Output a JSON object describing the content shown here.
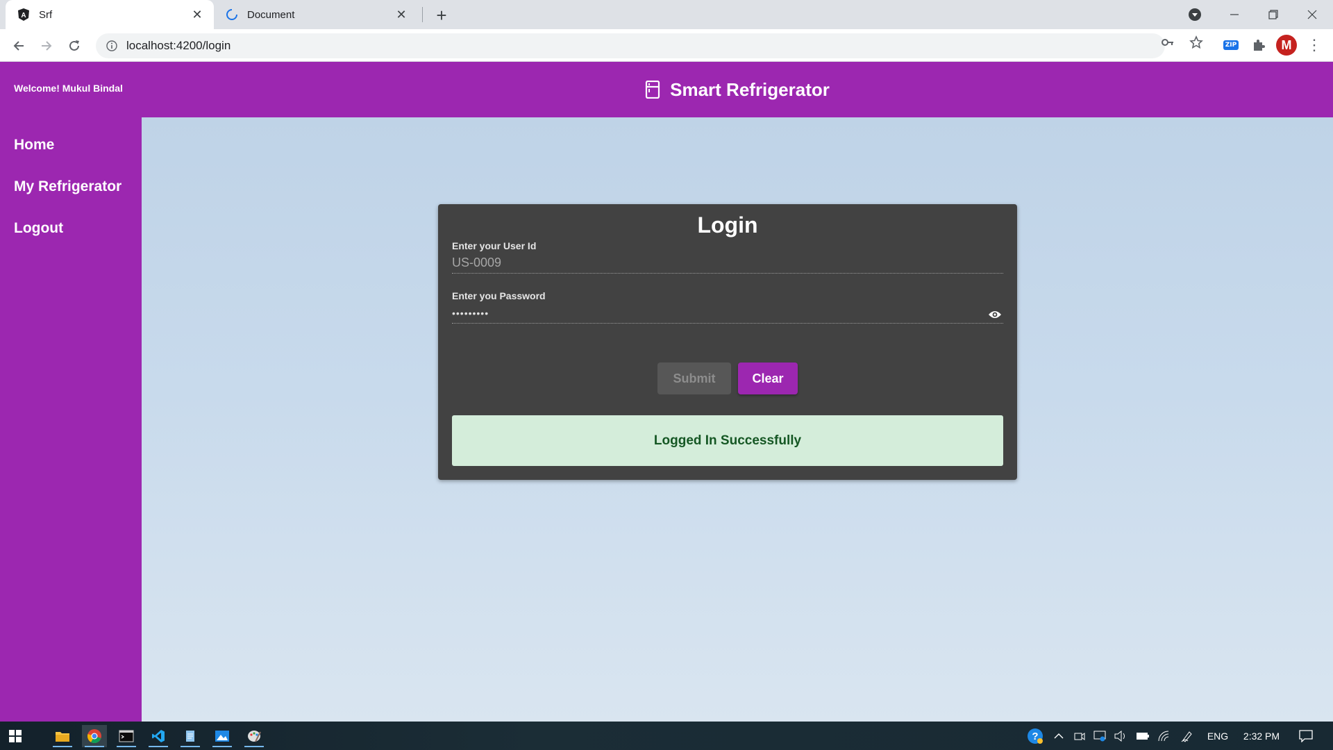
{
  "browser": {
    "tabs": [
      {
        "title": "Srf",
        "active": true
      },
      {
        "title": "Document",
        "active": false
      }
    ],
    "url": "localhost:4200/login"
  },
  "app": {
    "welcome": "Welcome! Mukul Bindal",
    "title": "Smart Refrigerator",
    "nav": [
      "Home",
      "My Refrigerator",
      "Logout"
    ]
  },
  "login": {
    "heading": "Login",
    "user_label": "Enter your User Id",
    "user_value": "US-0009",
    "password_label": "Enter you Password",
    "password_value": "•••••••••",
    "submit_label": "Submit",
    "clear_label": "Clear",
    "alert": "Logged In Successfully"
  },
  "colors": {
    "primary": "#9c27b0",
    "card": "#424242",
    "success_bg": "#d4edda",
    "success_text": "#155724"
  },
  "taskbar": {
    "language": "ENG",
    "time": "2:32 PM"
  }
}
